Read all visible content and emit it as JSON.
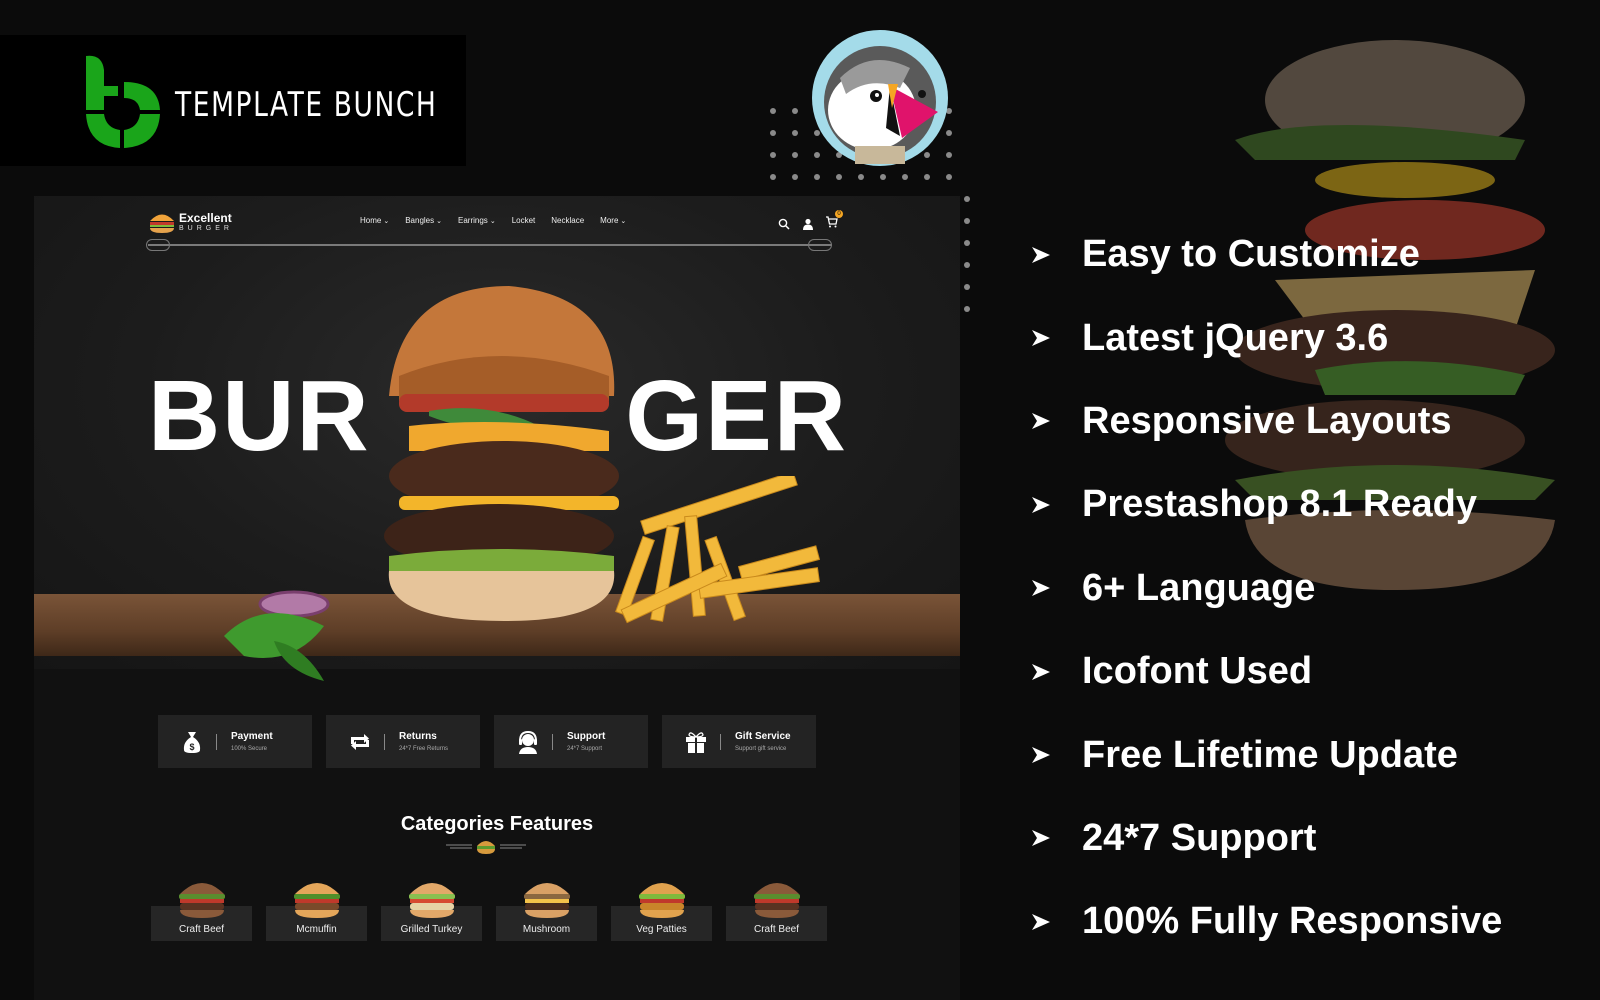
{
  "brand": {
    "name": "TEMPLATE BUNCH",
    "accent": "#1aa51a"
  },
  "platform_badge": {
    "name": "PrestaShop"
  },
  "site": {
    "logo": {
      "title": "Excellent",
      "subtitle": "BURGER"
    },
    "nav": [
      {
        "label": "Home",
        "has_dropdown": true
      },
      {
        "label": "Bangles",
        "has_dropdown": true
      },
      {
        "label": "Earrings",
        "has_dropdown": true
      },
      {
        "label": "Locket",
        "has_dropdown": false
      },
      {
        "label": "Necklace",
        "has_dropdown": false
      },
      {
        "label": "More",
        "has_dropdown": true
      }
    ],
    "icons": [
      "search-icon",
      "user-icon",
      "cart-icon"
    ],
    "cart_count": "0",
    "hero": {
      "title_left": "BUR",
      "title_right": "GER"
    },
    "services": [
      {
        "icon": "money-bag-icon",
        "title": "Payment",
        "subtitle": "100% Secure"
      },
      {
        "icon": "returns-icon",
        "title": "Returns",
        "subtitle": "24*7 Free Returns"
      },
      {
        "icon": "headset-icon",
        "title": "Support",
        "subtitle": "24*7 Support"
      },
      {
        "icon": "gift-icon",
        "title": "Gift Service",
        "subtitle": "Support gift service"
      }
    ],
    "categories_title": "Categories Features",
    "categories": [
      {
        "label": "Craft Beef"
      },
      {
        "label": "Mcmuffin"
      },
      {
        "label": "Grilled Turkey"
      },
      {
        "label": "Mushroom"
      },
      {
        "label": "Veg Patties"
      },
      {
        "label": "Craft Beef"
      }
    ]
  },
  "features": [
    "Easy to Customize",
    "Latest jQuery 3.6",
    "Responsive Layouts",
    "Prestashop 8.1 Ready",
    "6+ Language",
    "Icofont Used",
    "Free Lifetime Update",
    "24*7 Support",
    "100% Fully Responsive"
  ]
}
